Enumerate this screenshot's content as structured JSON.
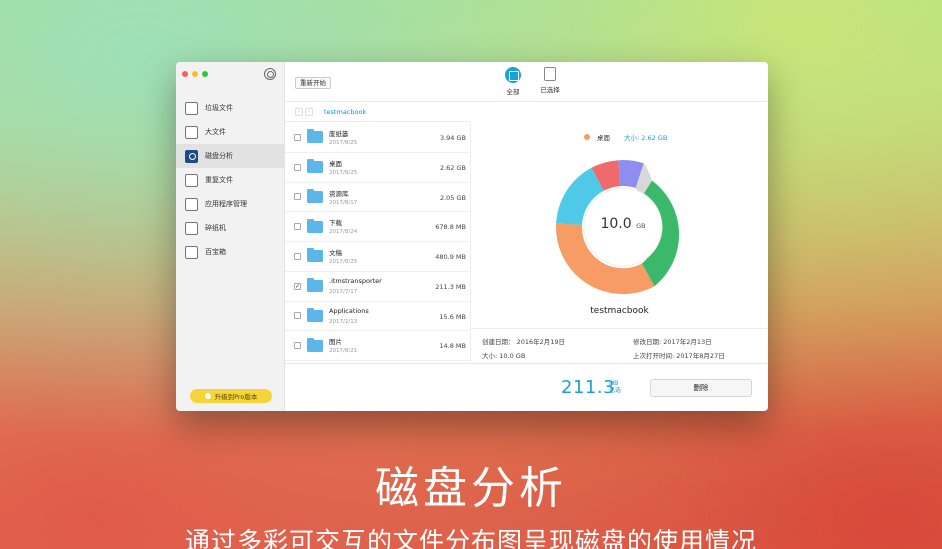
{
  "sidebar": {
    "items": [
      {
        "label": "垃圾文件",
        "icon": "trash-file-icon"
      },
      {
        "label": "大文件",
        "icon": "large-file-icon"
      },
      {
        "label": "磁盘分析",
        "icon": "disk-analysis-icon",
        "active": true
      },
      {
        "label": "重复文件",
        "icon": "duplicate-file-icon"
      },
      {
        "label": "应用程序管理",
        "icon": "app-manager-icon"
      },
      {
        "label": "碎纸机",
        "icon": "shredder-icon"
      },
      {
        "label": "百宝箱",
        "icon": "toolbox-icon"
      }
    ],
    "upgrade_label": "升级到Pro版本"
  },
  "toolbar": {
    "restart_label": "重新开始",
    "tabs": [
      {
        "label": "全部",
        "icon": "all-icon"
      },
      {
        "label": "已选择",
        "icon": "selected-icon"
      }
    ]
  },
  "path": {
    "back": "‹",
    "forward": "›",
    "current": "testmacbook"
  },
  "files": [
    {
      "name": "废纸篓",
      "date": "2017/8/25",
      "size": "3.94 GB",
      "checked": false
    },
    {
      "name": "桌面",
      "date": "2017/8/25",
      "size": "2.62 GB",
      "checked": false
    },
    {
      "name": "资源库",
      "date": "2017/8/17",
      "size": "2.05 GB",
      "checked": false
    },
    {
      "name": "下载",
      "date": "2017/8/24",
      "size": "678.8 MB",
      "checked": false
    },
    {
      "name": "文稿",
      "date": "2017/8/25",
      "size": "480.9 MB",
      "checked": false
    },
    {
      "name": ".itmstransporter",
      "date": "2017/7/17",
      "size": "211.3 MB",
      "checked": true
    },
    {
      "name": "Applications",
      "date": "2017/2/13",
      "size": "15.6 MB",
      "checked": false
    },
    {
      "name": "图片",
      "date": "2017/8/21",
      "size": "14.8 MB",
      "checked": false
    }
  ],
  "detail": {
    "legend_name": "桌面",
    "legend_size": "大小: 2.62 GB",
    "center_value": "10.0",
    "center_unit": "GB",
    "volume_name": "testmacbook",
    "created": "创建日期： 2016年2月19日",
    "modified": "修改日期: 2017年2月13日",
    "size": "大小: 10.0 GB",
    "last_opened": "上次打开时间: 2017年8月27日",
    "colors": {
      "trash": "#3bb96b",
      "desktop": "#f79c64",
      "library": "#4ec9e8",
      "downloads": "#ef6a6a",
      "docs": "#8e8ef0",
      "other": "#d8d8d8"
    }
  },
  "footer": {
    "selected_total": "211.3",
    "selected_unit": "MB",
    "selected_label": "已选",
    "delete_label": "删除"
  },
  "caption": {
    "title": "磁盘分析",
    "subtitle": "通过多彩可交互的文件分布图呈现磁盘的使用情况"
  }
}
